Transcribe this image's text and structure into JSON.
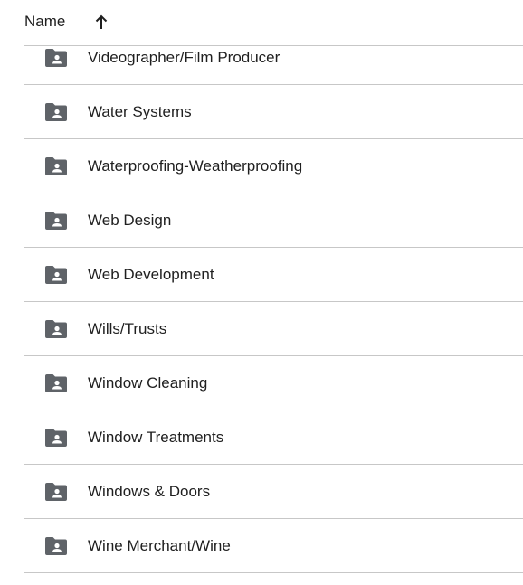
{
  "header": {
    "column_label": "Name",
    "sort_icon": "arrow-up-icon"
  },
  "folder_icon": "shared-folder-icon",
  "icon_color": "#5f6368",
  "folders": [
    {
      "name": "Videographer/Film Producer"
    },
    {
      "name": "Water Systems"
    },
    {
      "name": "Waterproofing-Weatherproofing"
    },
    {
      "name": "Web Design"
    },
    {
      "name": "Web Development"
    },
    {
      "name": "Wills/Trusts"
    },
    {
      "name": "Window Cleaning"
    },
    {
      "name": "Window Treatments"
    },
    {
      "name": "Windows & Doors"
    },
    {
      "name": "Wine Merchant/Wine"
    }
  ]
}
